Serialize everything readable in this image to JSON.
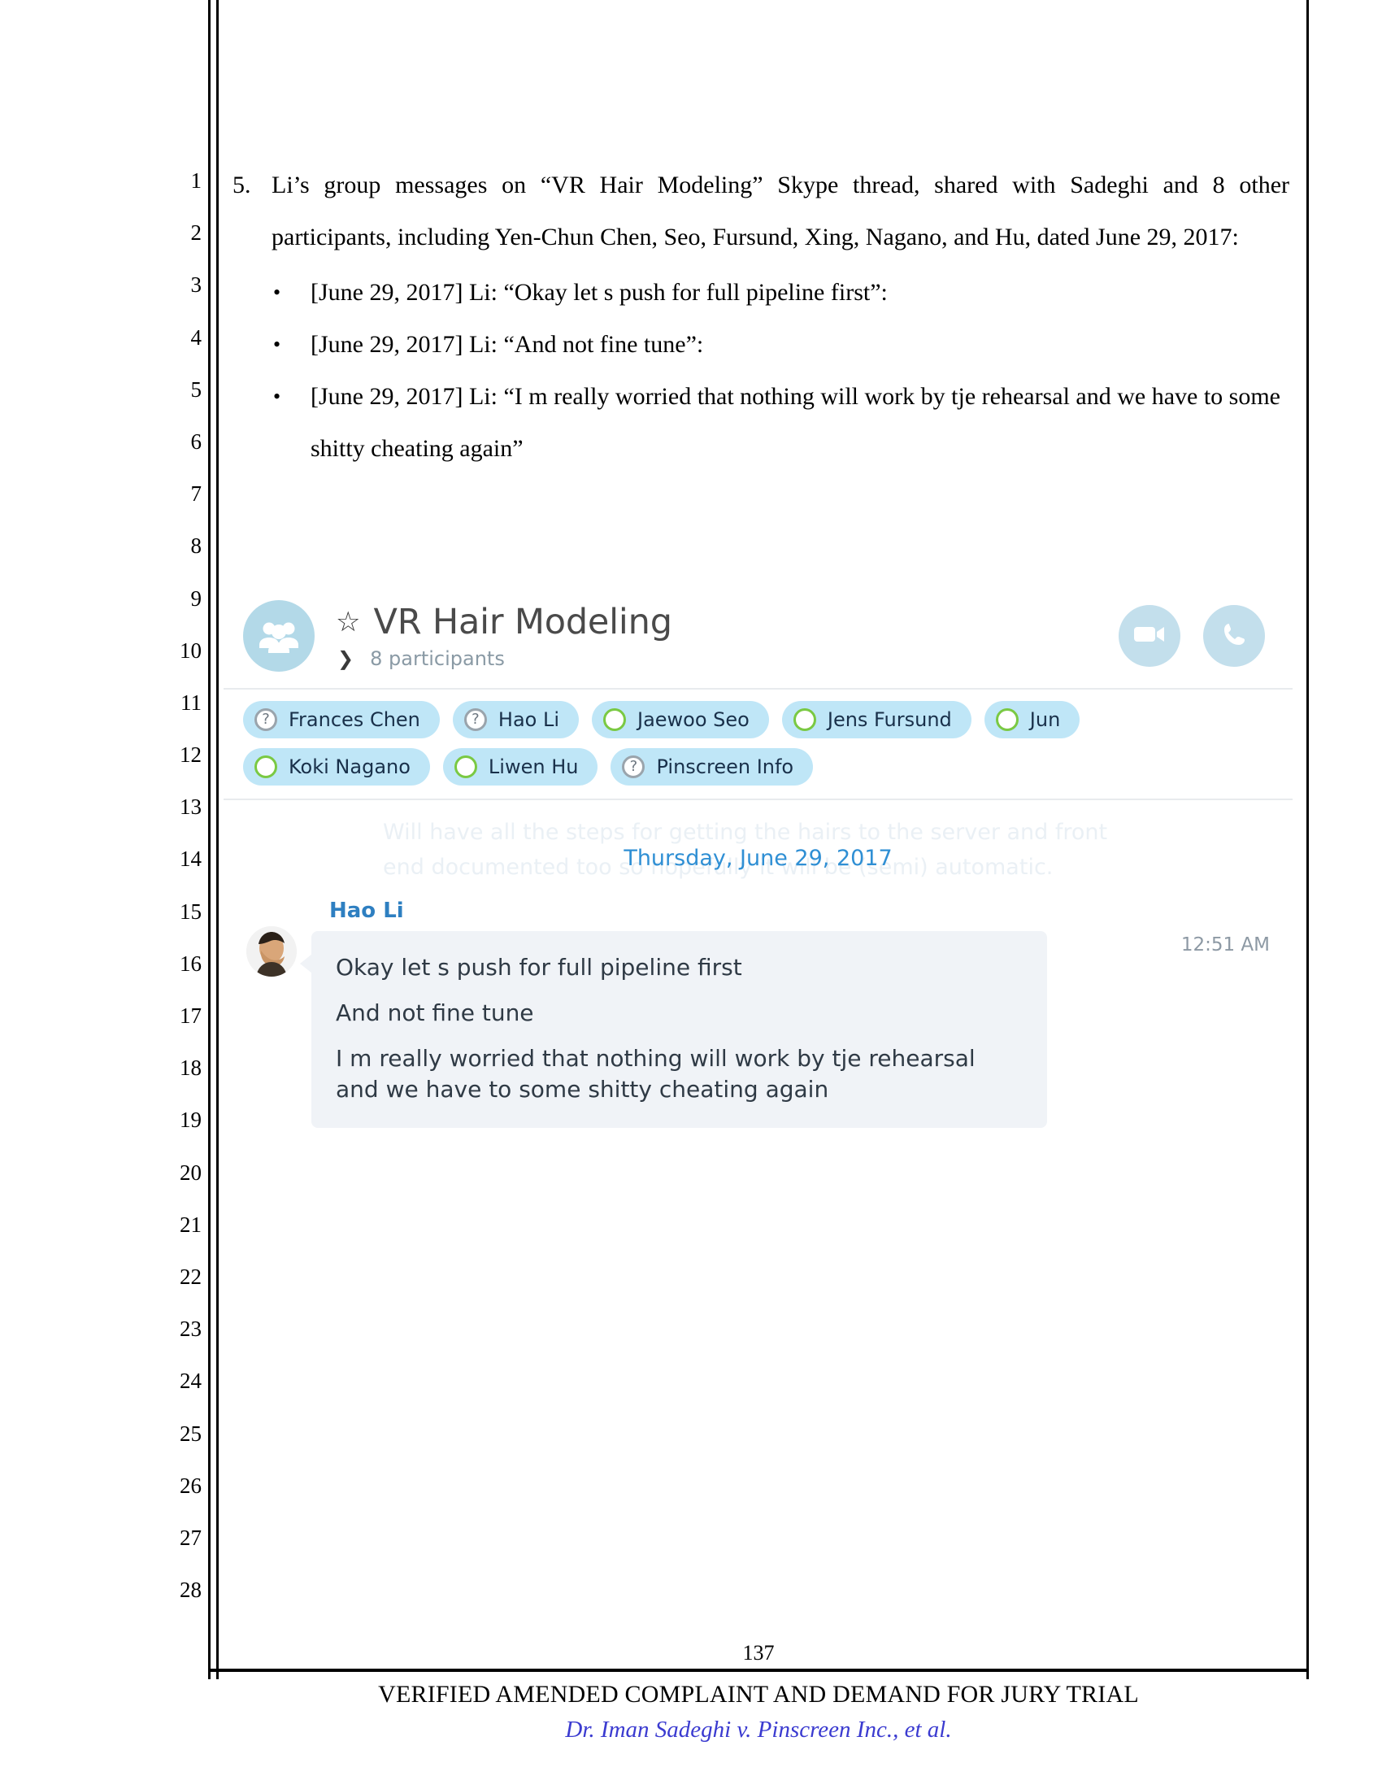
{
  "document": {
    "line_numbers": [
      "1",
      "2",
      "3",
      "4",
      "5",
      "6",
      "7",
      "8",
      "9",
      "10",
      "11",
      "12",
      "13",
      "14",
      "15",
      "16",
      "17",
      "18",
      "19",
      "20",
      "21",
      "22",
      "23",
      "24",
      "25",
      "26",
      "27",
      "28"
    ],
    "paragraph": {
      "number": "5.",
      "text": "Li’s group messages on “VR Hair Modeling” Skype thread, shared with Sadeghi and 8 other participants, including Yen-Chun Chen, Seo, Fursund, Xing, Nagano, and Hu, dated June 29, 2017:"
    },
    "bullets": [
      {
        "marker": "•",
        "text": "[June 29, 2017] Li: “Okay let s push for full pipeline first”:"
      },
      {
        "marker": "•",
        "text": "[June 29, 2017] Li: “And not fine tune”:"
      },
      {
        "marker": "•",
        "text": "[June 29, 2017] Li: “I m really worried that nothing will work by tje rehearsal and we have to some shitty cheating again”"
      }
    ],
    "footer": {
      "page_number": "137",
      "title": "VERIFIED AMENDED COMPLAINT AND DEMAND FOR JURY TRIAL",
      "case_caption": "Dr. Iman Sadeghi v. Pinscreen Inc., et al."
    }
  },
  "skype": {
    "header": {
      "star_icon": "star-icon",
      "title": "VR Hair Modeling",
      "chevron_icon": "chevron-down-icon",
      "participants_label": "8 participants",
      "group_avatar_icon": "group-people-icon",
      "video_call_icon": "video-camera-icon",
      "voice_call_icon": "phone-icon"
    },
    "participants": [
      {
        "name": "Frances Chen",
        "status": "unknown",
        "status_glyph": "?"
      },
      {
        "name": "Hao Li",
        "status": "unknown",
        "status_glyph": "?"
      },
      {
        "name": "Jaewoo Seo",
        "status": "online",
        "status_glyph": ""
      },
      {
        "name": "Jens Fursund",
        "status": "online",
        "status_glyph": ""
      },
      {
        "name": "Jun",
        "status": "online",
        "status_glyph": ""
      },
      {
        "name": "Koki Nagano",
        "status": "online",
        "status_glyph": ""
      },
      {
        "name": "Liwen Hu",
        "status": "online",
        "status_glyph": ""
      },
      {
        "name": "Pinscreen Info",
        "status": "unknown",
        "status_glyph": "?"
      }
    ],
    "conversation": {
      "faded_background_text": "Will have all the steps for getting the hairs to the server and front end documented too so hopefully it will be (semi) automatic.",
      "date_divider": "Thursday, June 29, 2017",
      "message": {
        "sender": "Hao Li",
        "timestamp": "12:51 AM",
        "lines": [
          "Okay let s push for full pipeline first",
          "And not fine tune",
          "I m really worried that nothing will work by tje rehearsal and we have to some shitty cheating again"
        ]
      }
    },
    "colors": {
      "chip_background": "#bfe6f7",
      "online_status": "#7ac943",
      "accent_blue": "#2f8fd4",
      "bubble_background": "#f0f3f7",
      "avatar_background": "#b3d9e8"
    }
  }
}
